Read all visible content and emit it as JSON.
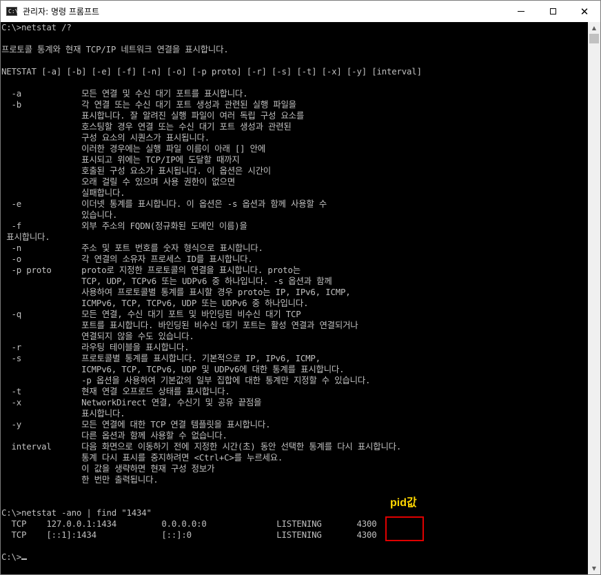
{
  "window": {
    "title": "관리자: 명령 프롬프트",
    "icon_text": "C:\\",
    "icon_name": "cmd-icon",
    "controls": {
      "minimize": "minimize-icon",
      "maximize": "maximize-icon",
      "close_glyph": "✕"
    }
  },
  "console": {
    "lines": [
      "C:\\>netstat /?",
      "",
      "프로토콜 통계와 현재 TCP/IP 네트워크 연결을 표시합니다.",
      "",
      "NETSTAT [-a] [-b] [-e] [-f] [-n] [-o] [-p proto] [-r] [-s] [-t] [-x] [-y] [interval]",
      "",
      "  -a            모든 연결 및 수신 대기 포트를 표시합니다.",
      "  -b            각 연결 또는 수신 대기 포트 생성과 관련된 실행 파일을",
      "                표시합니다. 잘 알려진 실행 파일이 여러 독립 구성 요소를",
      "                호스팅할 경우 연결 또는 수신 대기 포트 생성과 관련된",
      "                구성 요소의 시퀀스가 표시됩니다.",
      "                이러한 경우에는 실행 파일 이름이 아래 [] 안에",
      "                표시되고 위에는 TCP/IP에 도달할 때까지",
      "                호출된 구성 요소가 표시됩니다. 이 옵션은 시간이",
      "                오래 걸릴 수 있으며 사용 권한이 없으면",
      "                실패합니다.",
      "  -e            이더넷 통계를 표시합니다. 이 옵션은 -s 옵션과 함께 사용할 수",
      "                있습니다.",
      "  -f            외부 주소의 FQDN(정규화된 도메인 이름)을",
      " 표시합니다.",
      "  -n            주소 및 포트 번호를 숫자 형식으로 표시합니다.",
      "  -o            각 연결의 소유자 프로세스 ID를 표시합니다.",
      "  -p proto      proto로 지정한 프로토콜의 연결을 표시합니다. proto는",
      "                TCP, UDP, TCPv6 또는 UDPv6 중 하나입니다. -s 옵션과 함께",
      "                사용하여 프로토콜별 통계를 표시할 경우 proto는 IP, IPv6, ICMP,",
      "                ICMPv6, TCP, TCPv6, UDP 또는 UDPv6 중 하나입니다.",
      "  -q            모든 연결, 수신 대기 포트 및 바인딩된 비수신 대기 TCP",
      "                포트를 표시합니다. 바인딩된 비수신 대기 포트는 활성 연결과 연결되거나",
      "                연결되지 않을 수도 있습니다.",
      "  -r            라우팅 테이블을 표시합니다.",
      "  -s            프로토콜별 통계를 표시합니다. 기본적으로 IP, IPv6, ICMP,",
      "                ICMPv6, TCP, TCPv6, UDP 및 UDPv6에 대한 통계를 표시합니다.",
      "                -p 옵션을 사용하여 기본값의 일부 집합에 대한 통계만 지정할 수 있습니다.",
      "  -t            현재 연결 오프로드 상태를 표시합니다.",
      "  -x            NetworkDirect 연결, 수신기 및 공유 끝점을",
      "                표시합니다.",
      "  -y            모든 연결에 대한 TCP 연결 템플릿을 표시합니다.",
      "                다른 옵션과 함께 사용할 수 없습니다.",
      "  interval      다음 화면으로 이동하기 전에 지정한 시간(초) 동안 선택한 통계를 다시 표시합니다.",
      "                통계 다시 표시를 중지하려면 <Ctrl+C>를 누르세요.",
      "                이 값을 생략하면 현재 구성 정보가",
      "                한 번만 출력됩니다.",
      "",
      "",
      "C:\\>netstat -ano | find \"1434\"",
      "  TCP    127.0.0.1:1434         0.0.0.0:0              LISTENING       4300",
      "  TCP    [::1]:1434             [::]:0                 LISTENING       4300",
      "",
      "C:\\>"
    ]
  },
  "annotation": {
    "label": "pid값",
    "label_color": "#ffd700",
    "box_color": "#e00000"
  },
  "scrollbar": {
    "up_icon": "▲",
    "down_icon": "▼"
  }
}
